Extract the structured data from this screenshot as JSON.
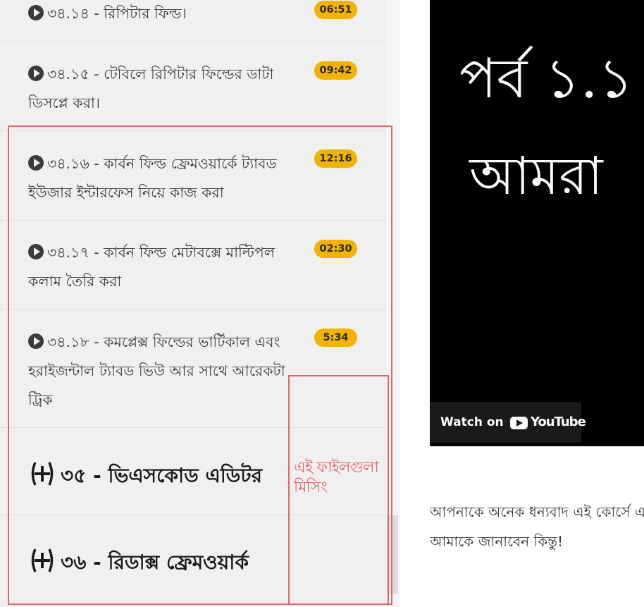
{
  "sidebar": {
    "lessons": [
      {
        "title": "৩৪.১৪ - রিপিটার ফিল্ড।",
        "duration": "06:51"
      },
      {
        "title": "৩৪.১৫ - টেবিলে রিপিটার ফিল্ডের ডাটা ডিসপ্লে করা।",
        "duration": "09:42"
      },
      {
        "title": "৩৪.১৬ - কার্বন ফিল্ড ফ্রেমওয়ার্কে ট্যাবড ইউজার ইন্টারফেস নিয়ে কাজ করা",
        "duration": "12:16"
      },
      {
        "title": "৩৪.১৭ - কার্বন ফিল্ড মেটাবক্সে মাল্টিপল কলাম তৈরি করা",
        "duration": "02:30"
      },
      {
        "title": "৩৪.১৮ - কমপ্লেক্স ফিল্ডের ভার্টিকাল এবং হরাইজন্টাল ট্যাবড ভিউ আর সাথে আরেকটা ট্রিক",
        "duration": "5:34"
      }
    ],
    "sections": [
      {
        "title": "৩৫ - ভিএসকোড এডিটর"
      },
      {
        "title": "৩৬ - রিডাক্স ফ্রেমওয়ার্ক"
      }
    ]
  },
  "annotation": {
    "text": "এই ফাইলগুলা মিসিং",
    "color": "#e7636a"
  },
  "video": {
    "overlay_line1": "পর্ব ১.১",
    "overlay_line2": "আমরা",
    "watch_on": "Watch on",
    "youtube": "YouTube"
  },
  "description": {
    "line1": "আপনাকে অনেক ধন্যবাদ এই কোর্সে এ",
    "line2": "আমাকে জানাবেন কিন্তু!"
  },
  "colors": {
    "badge": "#f0b400",
    "sidebar_bg": "#f0f0f0",
    "annotation": "#e7636a"
  }
}
